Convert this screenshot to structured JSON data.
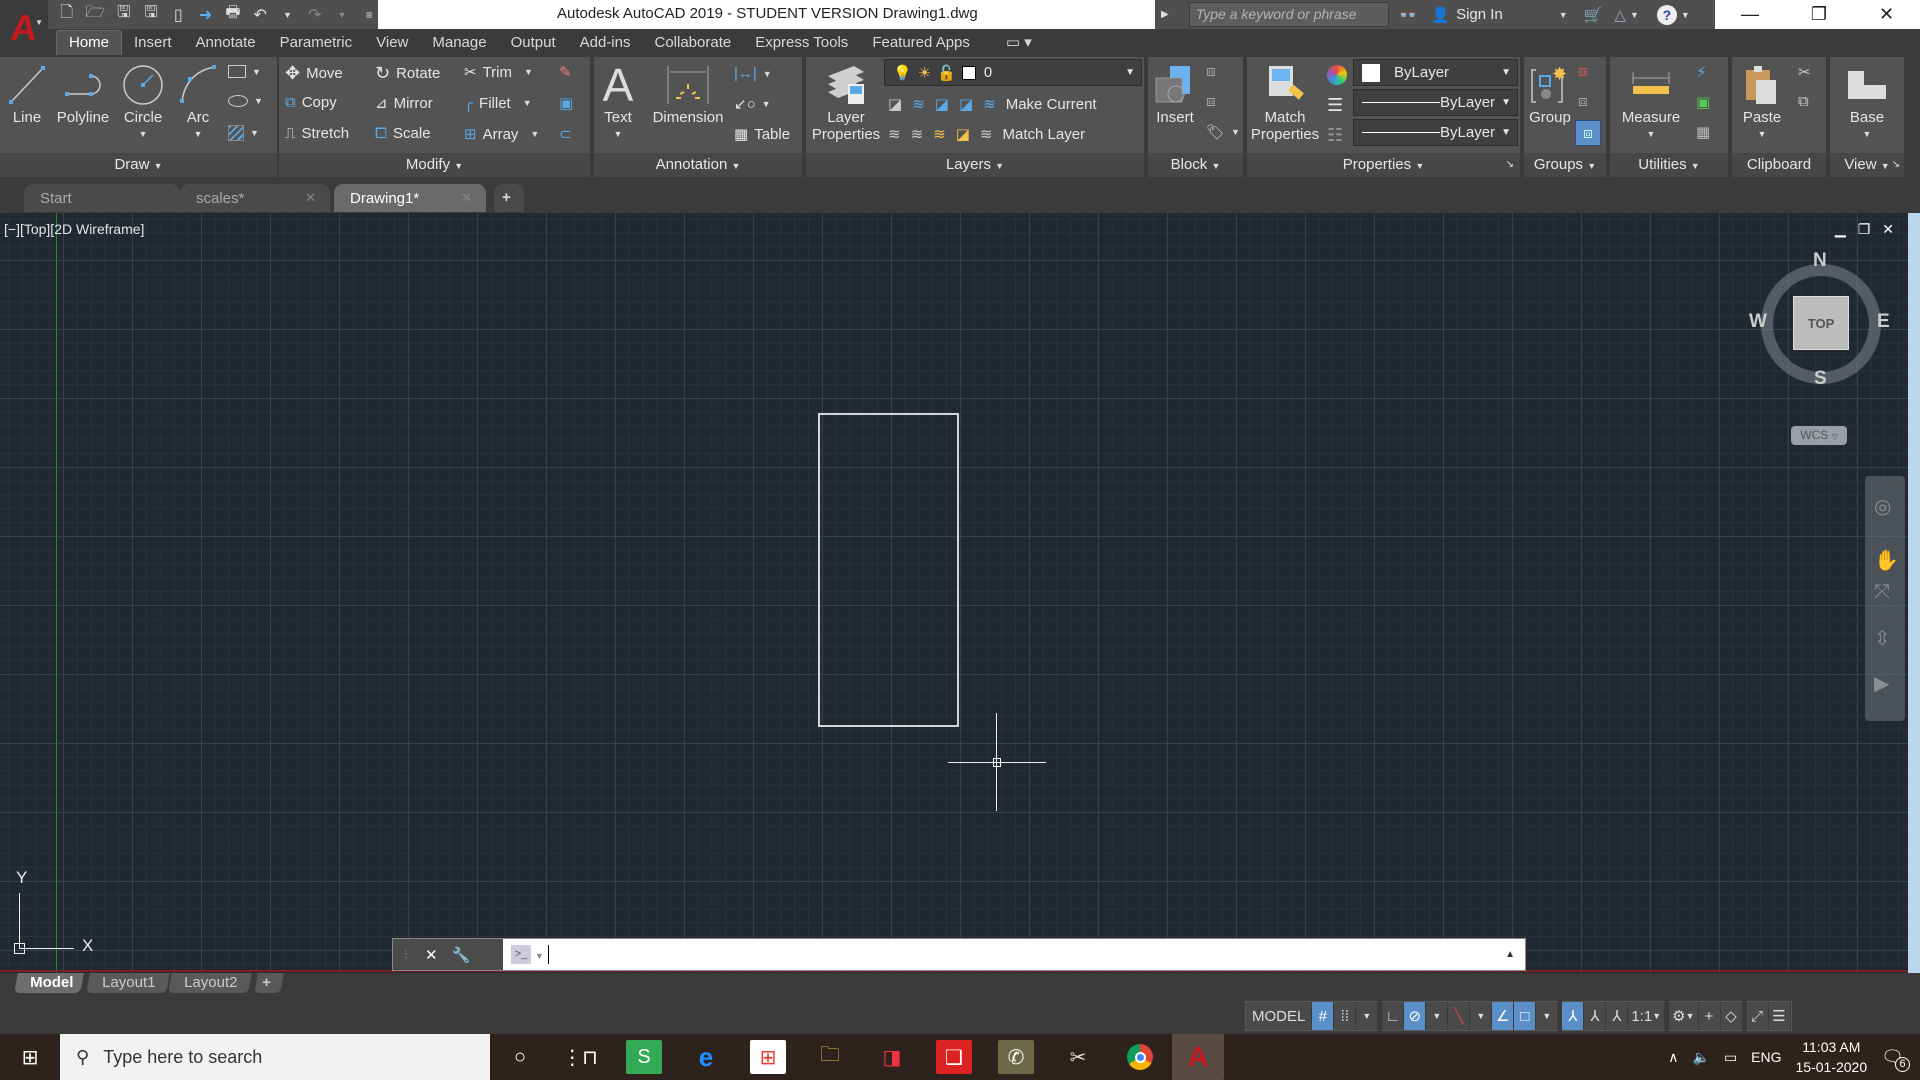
{
  "title_bar": {
    "window_title": "Autodesk AutoCAD 2019 - STUDENT VERSION    Drawing1.dwg",
    "search_placeholder": "Type a keyword or phrase",
    "sign_in": "Sign In",
    "quick_access": [
      "new-icon",
      "open-icon",
      "save-icon",
      "save-as-icon",
      "open-web-icon",
      "save-web-icon",
      "plot-icon",
      "undo-icon",
      "redo-icon",
      "customize-icon"
    ]
  },
  "ribbon_tabs": [
    {
      "label": "Home",
      "active": true
    },
    {
      "label": "Insert"
    },
    {
      "label": "Annotate"
    },
    {
      "label": "Parametric"
    },
    {
      "label": "View"
    },
    {
      "label": "Manage"
    },
    {
      "label": "Output"
    },
    {
      "label": "Add-ins"
    },
    {
      "label": "Collaborate"
    },
    {
      "label": "Express Tools"
    },
    {
      "label": "Featured Apps"
    }
  ],
  "panels": {
    "draw": {
      "title": "Draw",
      "line": "Line",
      "polyline": "Polyline",
      "circle": "Circle",
      "arc": "Arc"
    },
    "modify": {
      "title": "Modify",
      "move": "Move",
      "rotate": "Rotate",
      "trim": "Trim",
      "copy": "Copy",
      "mirror": "Mirror",
      "fillet": "Fillet",
      "stretch": "Stretch",
      "scale": "Scale",
      "array": "Array"
    },
    "annotation": {
      "title": "Annotation",
      "text": "Text",
      "dimension": "Dimension",
      "table": "Table"
    },
    "layers": {
      "title": "Layers",
      "layer_properties_1": "Layer",
      "layer_properties_2": "Properties",
      "current_layer": "0",
      "make_current": "Make Current",
      "match_layer": "Match Layer"
    },
    "block": {
      "title": "Block",
      "insert": "Insert"
    },
    "properties": {
      "title": "Properties",
      "match_1": "Match",
      "match_2": "Properties",
      "color": "ByLayer",
      "lineweight": "ByLayer",
      "linetype": "ByLayer"
    },
    "groups": {
      "title": "Groups",
      "group": "Group"
    },
    "utilities": {
      "title": "Utilities",
      "measure": "Measure"
    },
    "clipboard": {
      "title": "Clipboard",
      "paste": "Paste"
    },
    "view": {
      "title": "View",
      "base": "Base"
    }
  },
  "file_tabs": [
    {
      "label": "Start"
    },
    {
      "label": "scales*",
      "closable": true
    },
    {
      "label": "Drawing1*",
      "closable": true,
      "active": true
    }
  ],
  "viewport": {
    "label": "[−][Top][2D Wireframe]",
    "viewcube": {
      "n": "N",
      "s": "S",
      "e": "E",
      "w": "W",
      "face": "TOP",
      "ucs": "WCS"
    },
    "ucs_x": "X",
    "ucs_y": "Y"
  },
  "command_line": {
    "value": "",
    "placeholder": ""
  },
  "layout_tabs": [
    {
      "label": "Model",
      "active": true
    },
    {
      "label": "Layout1"
    },
    {
      "label": "Layout2"
    }
  ],
  "status_bar": {
    "space": "MODEL",
    "annotation_scale": "1:1",
    "grid_on": true,
    "polar_on": true,
    "dynamic_input_on": true,
    "selection_cycling_on": true,
    "annotation_visibility_on": true
  },
  "taskbar": {
    "search_placeholder": "Type here to search",
    "language": "ENG",
    "time": "11:03 AM",
    "date": "15-01-2020",
    "notifications": "6"
  },
  "colors": {
    "accent_blue": "#5b8fc9",
    "autocad_red": "#c8191c",
    "canvas": "#212830"
  }
}
